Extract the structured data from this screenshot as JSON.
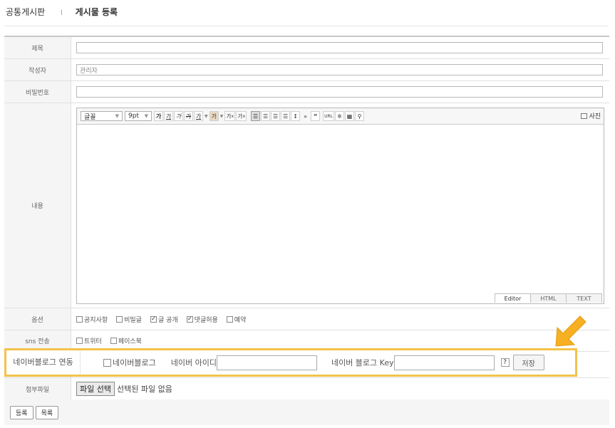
{
  "breadcrumb": {
    "section": "공통게시판",
    "separator": "l",
    "current": "게시물 등록"
  },
  "form": {
    "title_label": "제목",
    "title_value": "",
    "author_label": "작성자",
    "author_value": "관리자",
    "password_label": "비밀번호",
    "password_value": "",
    "content_label": "내용",
    "options_label": "옵션",
    "sns_label": "sns 전송",
    "attach_label": "첨부파일"
  },
  "editor": {
    "font_select": "글꼴",
    "size_select": "9pt",
    "buttons": [
      "가",
      "가",
      "가",
      "가",
      "가",
      "가",
      "가",
      "가",
      "가"
    ],
    "photo_label": "사진",
    "mode_tabs": [
      "Editor",
      "HTML",
      "TEXT"
    ],
    "active_mode": "Editor"
  },
  "options": [
    {
      "label": "공지사항",
      "checked": false
    },
    {
      "label": "비밀글",
      "checked": false
    },
    {
      "label": "글 공개",
      "checked": true
    },
    {
      "label": "댓글허용",
      "checked": true
    },
    {
      "label": "예약",
      "checked": false
    }
  ],
  "sns": [
    {
      "label": "트위터",
      "checked": false
    },
    {
      "label": "페이스북",
      "checked": false
    }
  ],
  "naver": {
    "label": "네이버블로그 연동",
    "checkbox_label": "네이버블로그",
    "checked": false,
    "id_label": "네이버 아이디",
    "id_value": "",
    "key_label": "네이버 블로그 Key",
    "key_value": "",
    "help": "?",
    "save": "저장"
  },
  "file": {
    "button": "파일 선택",
    "status": "선택된 파일 없음"
  },
  "actions": {
    "submit": "등록",
    "list": "목록"
  },
  "colors": {
    "highlight": "#f2c24a",
    "arrow": "#f6b021"
  }
}
